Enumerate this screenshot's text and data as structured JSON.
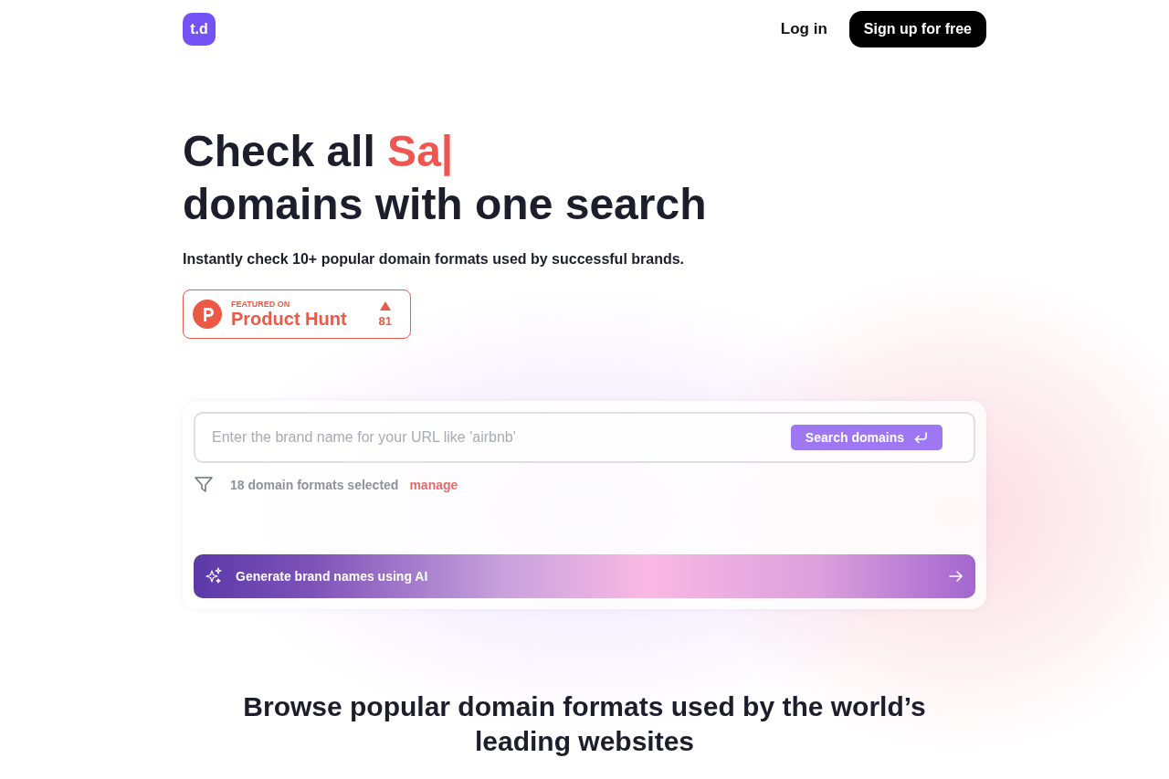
{
  "header": {
    "logo": "t.d",
    "login": "Log in",
    "signup": "Sign up for free"
  },
  "hero": {
    "title_prefix": "Check all ",
    "title_highlight": "Sa|",
    "title_rest": "domains with one search",
    "subtitle": "Instantly check 10+ popular domain formats used by successful brands."
  },
  "badge": {
    "featured": "FEATURED ON",
    "name": "Product Hunt",
    "votes": "81"
  },
  "search": {
    "placeholder": "Enter the brand name for your URL like 'airbnb'",
    "button": "Search domains",
    "formats": "18 domain formats selected",
    "manage": "manage",
    "ai_button": "Generate brand names using AI"
  },
  "section": {
    "title": "Browse popular domain formats used by the world’s leading websites"
  }
}
